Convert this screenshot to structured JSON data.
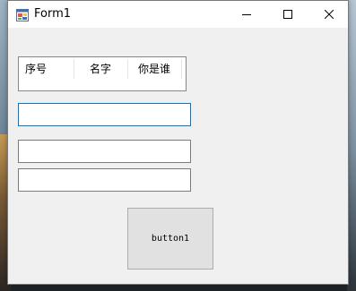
{
  "window": {
    "title": "Form1"
  },
  "listview": {
    "columns": [
      "序号",
      "名字",
      "你是谁"
    ]
  },
  "inputs": [
    {
      "value": "",
      "placeholder": ""
    },
    {
      "value": "",
      "placeholder": ""
    },
    {
      "value": "",
      "placeholder": ""
    }
  ],
  "button": {
    "label": "button1"
  },
  "colors": {
    "form_background": "#f0f0f0",
    "focus_border": "#0078d7",
    "button_face": "#e1e1e1"
  }
}
